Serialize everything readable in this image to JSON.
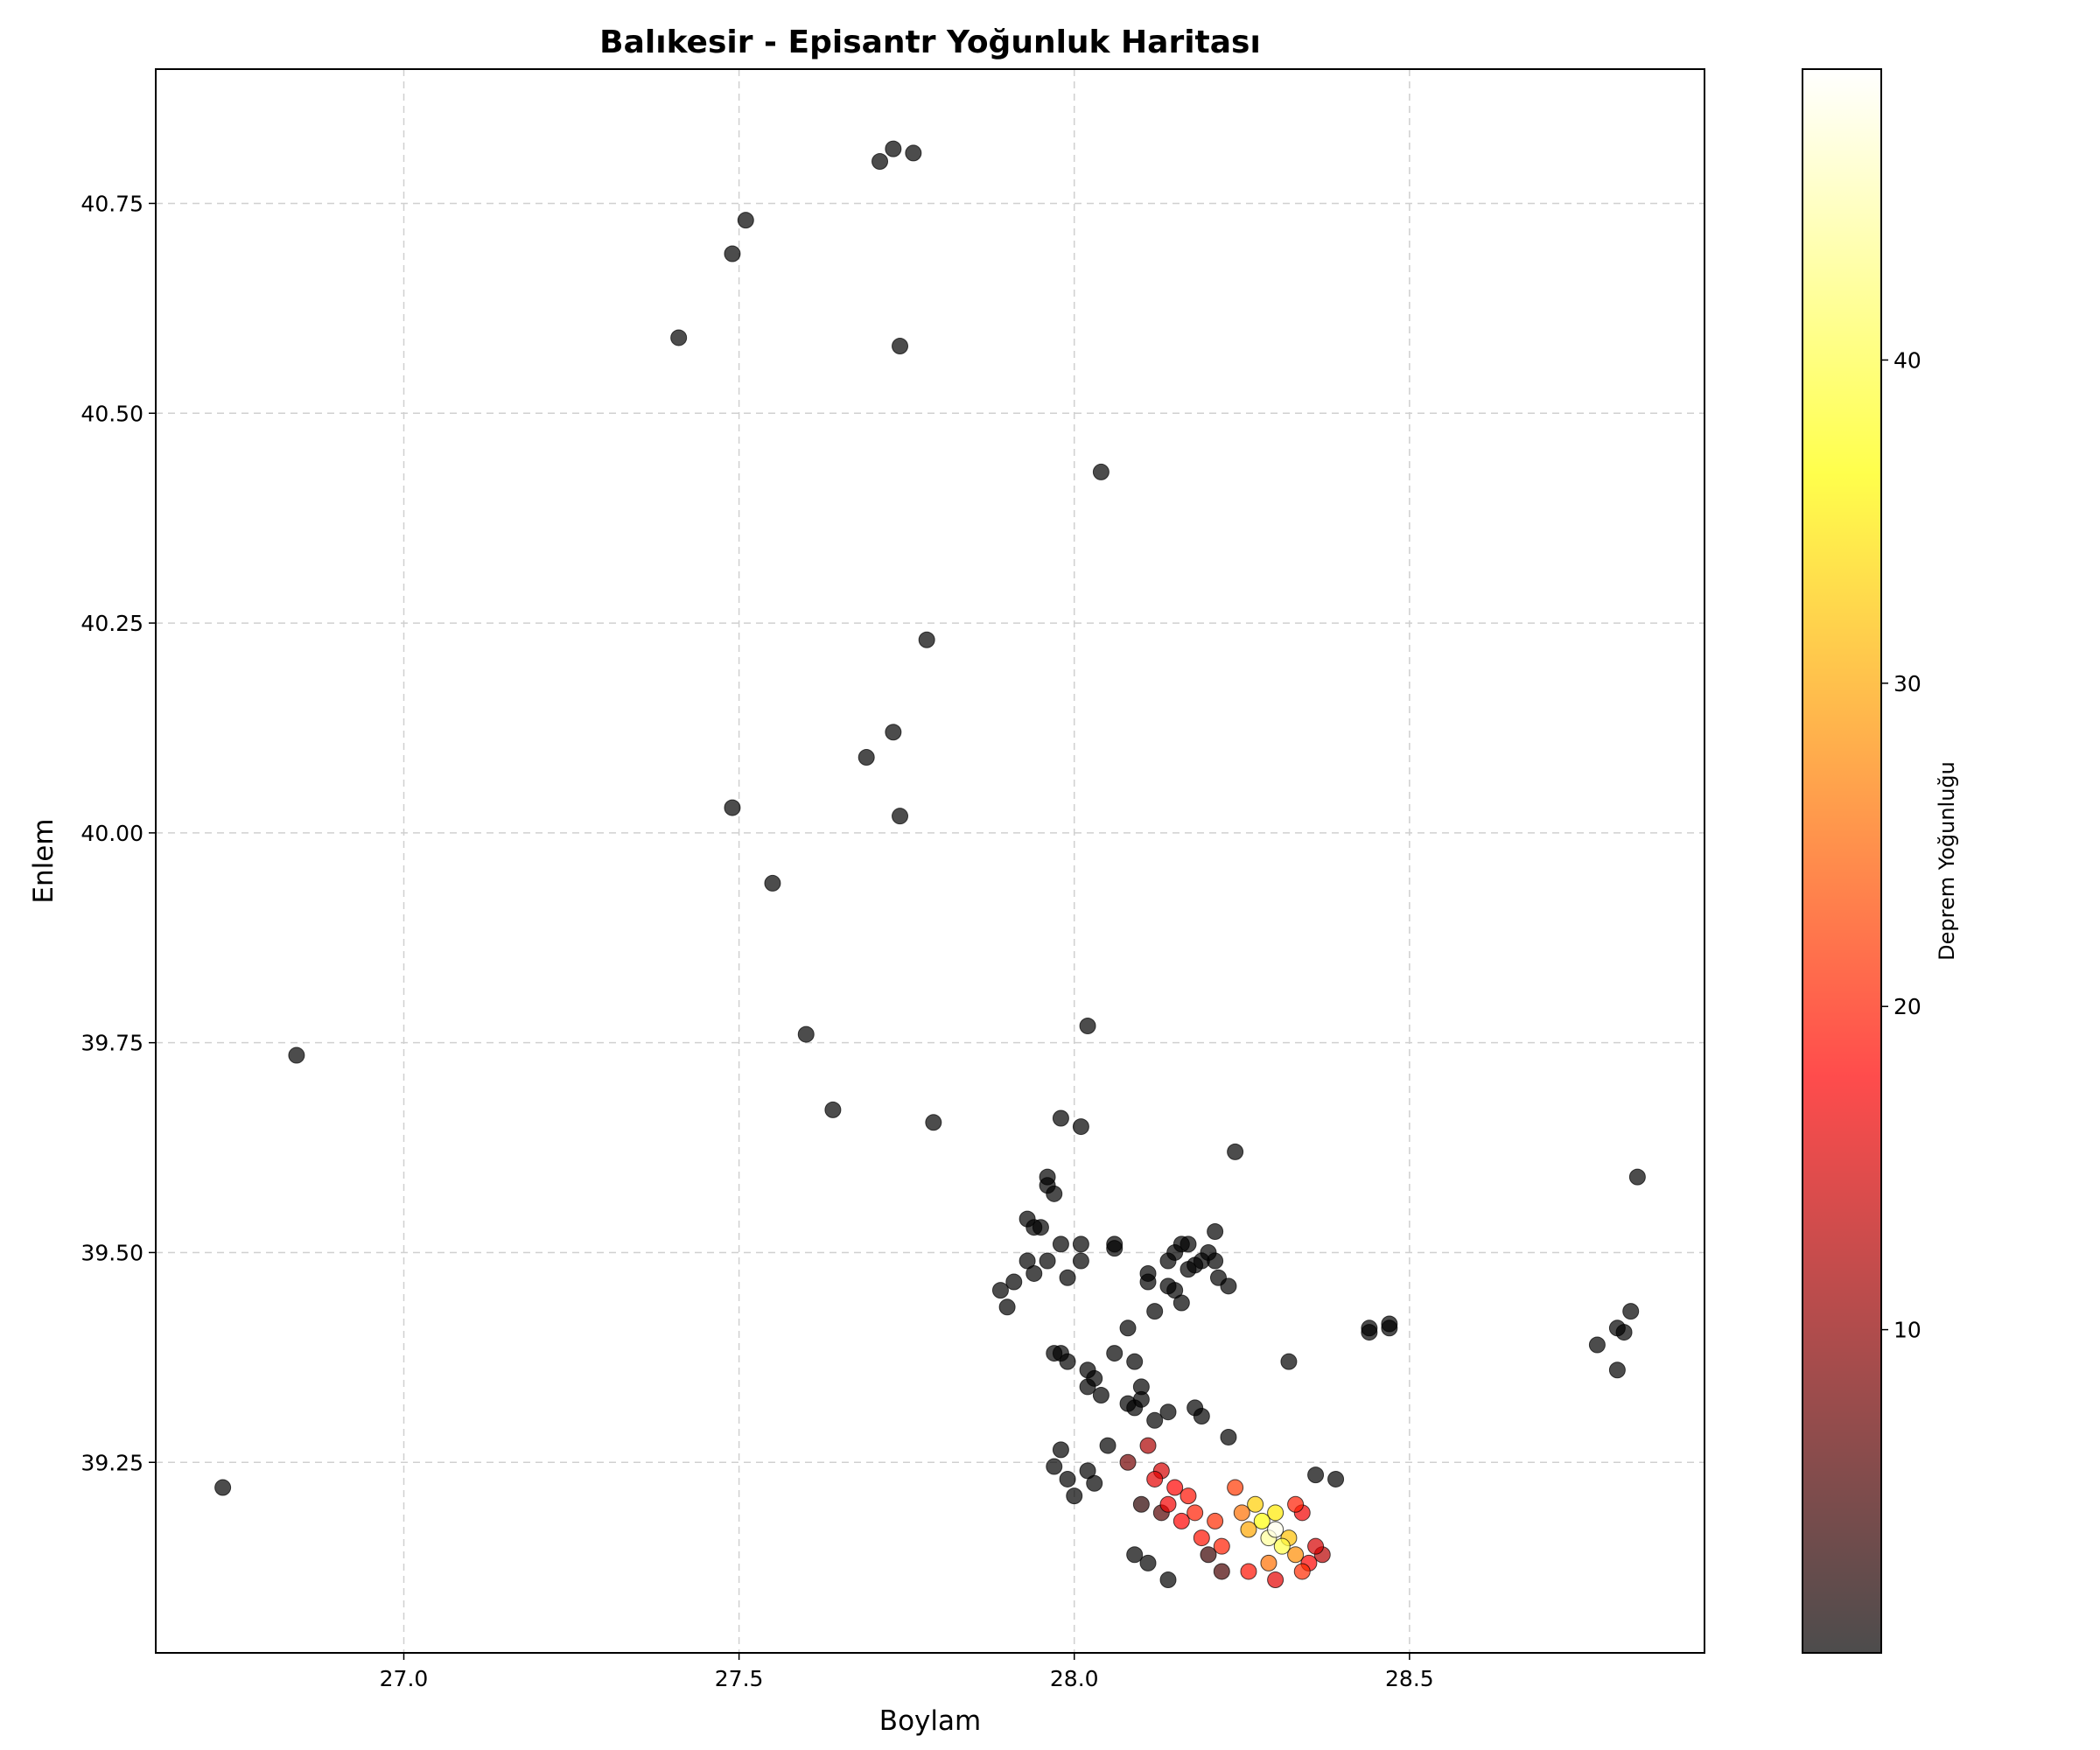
{
  "chart_data": {
    "type": "scatter",
    "title": "Balıkesir - Episantr Yoğunluk Haritası",
    "xlabel": "Boylam",
    "ylabel": "Enlem",
    "xlim": [
      26.63,
      28.94
    ],
    "ylim": [
      39.023,
      40.91
    ],
    "xticks": [
      "27.0",
      "27.5",
      "28.0",
      "28.5"
    ],
    "yticks": [
      "39.25",
      "39.50",
      "39.75",
      "40.00",
      "40.25",
      "40.50",
      "40.75"
    ],
    "grid": true,
    "colorbar": {
      "label": "Deprem Yoğunluğu",
      "range": [
        0,
        49
      ],
      "ticks": [
        "10",
        "20",
        "30",
        "40"
      ],
      "colormap": [
        "#000000",
        "#ff0000",
        "#ffff00",
        "#ffffff"
      ]
    },
    "marker_alpha": 0.7,
    "points": [
      [
        27.71,
        40.8,
        0
      ],
      [
        27.73,
        40.815,
        0
      ],
      [
        27.76,
        40.81,
        0
      ],
      [
        27.51,
        40.73,
        0
      ],
      [
        27.49,
        40.69,
        0
      ],
      [
        27.41,
        40.59,
        0
      ],
      [
        27.74,
        40.58,
        0
      ],
      [
        28.04,
        40.43,
        0
      ],
      [
        27.78,
        40.23,
        0
      ],
      [
        27.73,
        40.12,
        0
      ],
      [
        27.69,
        40.09,
        0
      ],
      [
        27.49,
        40.03,
        0
      ],
      [
        27.74,
        40.02,
        0
      ],
      [
        27.55,
        39.94,
        0
      ],
      [
        26.84,
        39.735,
        0
      ],
      [
        27.6,
        39.76,
        0
      ],
      [
        28.02,
        39.77,
        0
      ],
      [
        27.64,
        39.67,
        0
      ],
      [
        27.79,
        39.655,
        0
      ],
      [
        27.98,
        39.66,
        0
      ],
      [
        28.01,
        39.65,
        0
      ],
      [
        28.24,
        39.62,
        0
      ],
      [
        28.84,
        39.59,
        0
      ],
      [
        27.96,
        39.59,
        0
      ],
      [
        27.96,
        39.58,
        0
      ],
      [
        27.97,
        39.57,
        0
      ],
      [
        27.93,
        39.54,
        0
      ],
      [
        27.94,
        39.53,
        0
      ],
      [
        27.95,
        39.53,
        0
      ],
      [
        27.98,
        39.51,
        0
      ],
      [
        28.01,
        39.51,
        0
      ],
      [
        28.06,
        39.51,
        0
      ],
      [
        28.06,
        39.505,
        0
      ],
      [
        27.93,
        39.49,
        0
      ],
      [
        27.96,
        39.49,
        0
      ],
      [
        28.01,
        39.49,
        0
      ],
      [
        27.94,
        39.475,
        0
      ],
      [
        27.99,
        39.47,
        0
      ],
      [
        27.91,
        39.465,
        0
      ],
      [
        27.89,
        39.455,
        0
      ],
      [
        27.9,
        39.435,
        0
      ],
      [
        28.11,
        39.475,
        0
      ],
      [
        28.11,
        39.465,
        0
      ],
      [
        28.14,
        39.49,
        0
      ],
      [
        28.15,
        39.5,
        0
      ],
      [
        28.16,
        39.51,
        0
      ],
      [
        28.17,
        39.51,
        0
      ],
      [
        28.17,
        39.48,
        0
      ],
      [
        28.18,
        39.485,
        0
      ],
      [
        28.19,
        39.49,
        0
      ],
      [
        28.2,
        39.5,
        0
      ],
      [
        28.21,
        39.525,
        0
      ],
      [
        28.21,
        39.49,
        0
      ],
      [
        28.215,
        39.47,
        0
      ],
      [
        28.23,
        39.46,
        0
      ],
      [
        28.14,
        39.46,
        0
      ],
      [
        28.15,
        39.455,
        0
      ],
      [
        28.16,
        39.44,
        0
      ],
      [
        28.12,
        39.43,
        0
      ],
      [
        28.44,
        39.41,
        0
      ],
      [
        28.44,
        39.405,
        0
      ],
      [
        28.47,
        39.415,
        0
      ],
      [
        28.47,
        39.41,
        0
      ],
      [
        28.83,
        39.43,
        0
      ],
      [
        28.81,
        39.41,
        0
      ],
      [
        28.82,
        39.405,
        0
      ],
      [
        28.78,
        39.39,
        0
      ],
      [
        28.81,
        39.36,
        0
      ],
      [
        28.32,
        39.37,
        0
      ],
      [
        27.97,
        39.38,
        0
      ],
      [
        27.98,
        39.38,
        0
      ],
      [
        27.99,
        39.37,
        0
      ],
      [
        28.06,
        39.38,
        0
      ],
      [
        28.08,
        39.41,
        0
      ],
      [
        28.09,
        39.37,
        0
      ],
      [
        28.02,
        39.36,
        0
      ],
      [
        28.03,
        39.35,
        0
      ],
      [
        28.02,
        39.34,
        0
      ],
      [
        28.04,
        39.33,
        0
      ],
      [
        28.1,
        39.34,
        0
      ],
      [
        28.1,
        39.325,
        0
      ],
      [
        28.08,
        39.32,
        0
      ],
      [
        28.09,
        39.315,
        0
      ],
      [
        28.12,
        39.3,
        0
      ],
      [
        28.14,
        39.31,
        0
      ],
      [
        28.18,
        39.315,
        0
      ],
      [
        28.19,
        39.305,
        0
      ],
      [
        28.23,
        39.28,
        0
      ],
      [
        26.73,
        39.22,
        0
      ],
      [
        28.36,
        39.235,
        0
      ],
      [
        28.39,
        39.23,
        0
      ],
      [
        27.97,
        39.245,
        0
      ],
      [
        27.98,
        39.265,
        0
      ],
      [
        27.99,
        39.23,
        0
      ],
      [
        28.0,
        39.21,
        0
      ],
      [
        28.02,
        39.24,
        0
      ],
      [
        28.03,
        39.225,
        0
      ],
      [
        28.05,
        39.27,
        0
      ],
      [
        28.09,
        39.14,
        0
      ],
      [
        28.11,
        39.13,
        0
      ],
      [
        28.14,
        39.11,
        0
      ],
      [
        28.1,
        39.2,
        3
      ],
      [
        28.13,
        39.19,
        6
      ],
      [
        28.2,
        39.14,
        4
      ],
      [
        28.22,
        39.12,
        5
      ],
      [
        28.08,
        39.25,
        8
      ],
      [
        28.11,
        39.27,
        12
      ],
      [
        28.13,
        39.24,
        15
      ],
      [
        28.15,
        39.22,
        18
      ],
      [
        28.17,
        39.21,
        19
      ],
      [
        28.14,
        39.2,
        17
      ],
      [
        28.18,
        39.19,
        20
      ],
      [
        28.21,
        39.18,
        21
      ],
      [
        28.12,
        39.23,
        16
      ],
      [
        28.16,
        39.18,
        18
      ],
      [
        28.19,
        39.16,
        19
      ],
      [
        28.22,
        39.15,
        20
      ],
      [
        28.24,
        39.22,
        22
      ],
      [
        28.25,
        39.19,
        26
      ],
      [
        28.26,
        39.17,
        30
      ],
      [
        28.27,
        39.2,
        33
      ],
      [
        28.28,
        39.18,
        37
      ],
      [
        28.29,
        39.16,
        44
      ],
      [
        28.3,
        39.17,
        48
      ],
      [
        28.31,
        39.15,
        40
      ],
      [
        28.3,
        39.19,
        35
      ],
      [
        28.32,
        39.16,
        32
      ],
      [
        28.33,
        39.14,
        28
      ],
      [
        28.29,
        39.13,
        26
      ],
      [
        28.34,
        39.12,
        21
      ],
      [
        28.35,
        39.13,
        18
      ],
      [
        28.36,
        39.15,
        15
      ],
      [
        28.37,
        39.14,
        13
      ],
      [
        28.33,
        39.2,
        20
      ],
      [
        28.34,
        39.19,
        17
      ],
      [
        28.3,
        39.11,
        16
      ],
      [
        28.26,
        39.12,
        19
      ]
    ]
  }
}
